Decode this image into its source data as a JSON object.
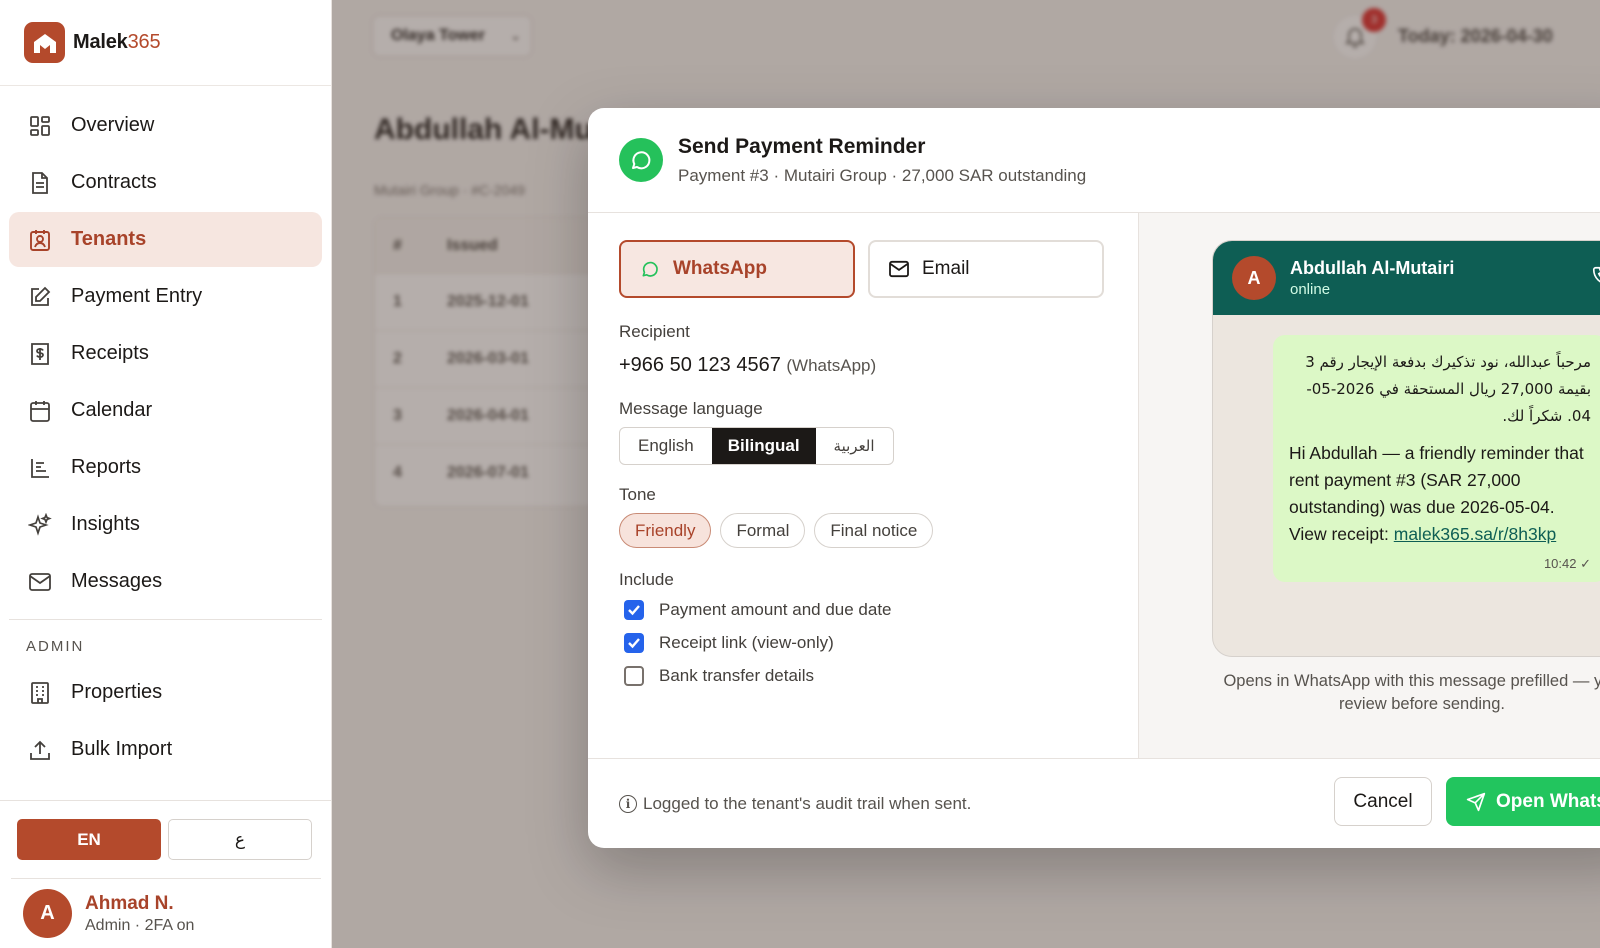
{
  "brand": {
    "name_main": "Malek",
    "name_accent": "365"
  },
  "sidebar": {
    "items": [
      {
        "label": "Overview",
        "icon": "grid-icon"
      },
      {
        "label": "Contracts",
        "icon": "document-icon"
      },
      {
        "label": "Tenants",
        "icon": "id-badge-icon",
        "active": true
      },
      {
        "label": "Payment Entry",
        "icon": "edit-icon"
      },
      {
        "label": "Receipts",
        "icon": "receipt-icon"
      },
      {
        "label": "Calendar",
        "icon": "calendar-icon"
      },
      {
        "label": "Reports",
        "icon": "bar-chart-icon"
      },
      {
        "label": "Insights",
        "icon": "sparkles-icon"
      },
      {
        "label": "Messages",
        "icon": "mail-icon"
      }
    ],
    "admin_label": "ADMIN",
    "admin_items": [
      {
        "label": "Properties",
        "icon": "building-icon"
      },
      {
        "label": "Bulk Import",
        "icon": "upload-icon"
      }
    ],
    "lang_en": "EN",
    "lang_ar": "ع",
    "user": {
      "initial": "A",
      "name": "Ahmad N.",
      "role": "Admin · 2FA on"
    }
  },
  "background": {
    "property_select": "Olaya Tower",
    "notifications": "3",
    "today": "Today: 2026-04-30",
    "tenant_title": "Abdullah Al-Mu",
    "tenant_sub": "Mutairi Group · #C-2049",
    "table_headers": [
      "#",
      "Issued"
    ],
    "table_rows": [
      [
        "1",
        "2025-12-01"
      ],
      [
        "2",
        "2026-03-01"
      ],
      [
        "3",
        "2026-04-01"
      ],
      [
        "4",
        "2026-07-01"
      ]
    ]
  },
  "modal": {
    "title": "Send Payment Reminder",
    "subtitle": "Payment #3 · Mutairi Group · 27,000 SAR outstanding",
    "channels": {
      "whatsapp": "WhatsApp",
      "email": "Email",
      "selected": "whatsapp"
    },
    "recipient_label": "Recipient",
    "recipient_value": "+966 50 123 4567",
    "recipient_via": "(WhatsApp)",
    "language_label": "Message language",
    "languages": [
      "English",
      "Bilingual",
      "العربية"
    ],
    "language_selected": "Bilingual",
    "tone_label": "Tone",
    "tones": [
      "Friendly",
      "Formal",
      "Final notice"
    ],
    "tone_selected": "Friendly",
    "include_label": "Include",
    "include": [
      {
        "label": "Payment amount and due date",
        "checked": true
      },
      {
        "label": "Receipt link (view-only)",
        "checked": true
      },
      {
        "label": "Bank transfer details",
        "checked": false
      }
    ],
    "preview": {
      "contact_initial": "A",
      "contact_name": "Abdullah Al-Mutairi",
      "contact_status": "online",
      "message_ar": "مرحباً عبدالله، نود تذكيرك بدفعة الإيجار رقم 3 بقيمة 27,000 ريال المستحقة في 2026-05-04. شكراً لك.",
      "message_en": "Hi Abdullah — a friendly reminder that rent payment #3 (SAR 27,000 outstanding) was due 2026-05-04. View receipt:",
      "message_link": "malek365.sa/r/8h3kp",
      "time": "10:42 ✓",
      "note": "Opens in WhatsApp with this message prefilled — you review before sending."
    },
    "footer_note": "Logged to the tenant's audit trail when sent.",
    "cancel": "Cancel",
    "open": "Open WhatsApp"
  },
  "colors": {
    "brand": "#b44a2c",
    "whatsapp": "#25c15b",
    "wa_header": "#0e5e54",
    "bubble": "#dcf8c6",
    "checkbox": "#2563eb"
  }
}
